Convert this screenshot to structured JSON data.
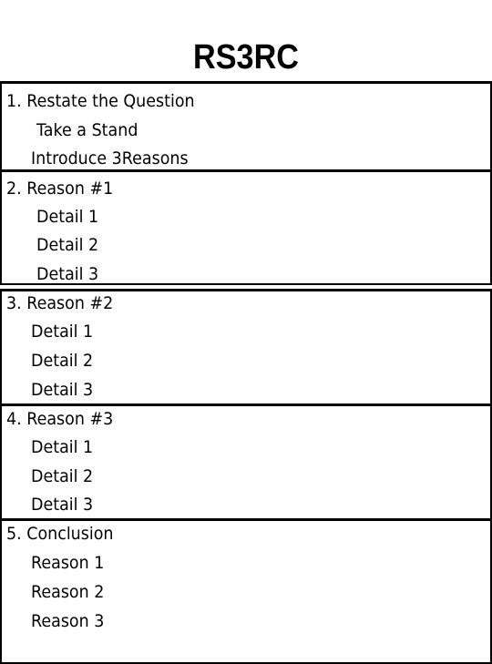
{
  "title": "RS3RC",
  "sections": [
    {
      "heading": "1. Restate the Question",
      "items": [
        "Take a Stand",
        "Introduce 3Reasons"
      ]
    },
    {
      "heading": "2. Reason #1",
      "items": [
        "Detail 1",
        "Detail 2",
        "Detail 3"
      ]
    },
    {
      "heading": "3. Reason #2",
      "items": [
        "Detail 1",
        "Detail 2",
        "Detail 3"
      ]
    },
    {
      "heading": "4. Reason #3",
      "items": [
        "Detail 1",
        "Detail 2",
        "Detail 3"
      ]
    },
    {
      "heading": "5. Conclusion",
      "items": [
        "Reason 1",
        "Reason 2",
        "Reason 3"
      ]
    }
  ]
}
